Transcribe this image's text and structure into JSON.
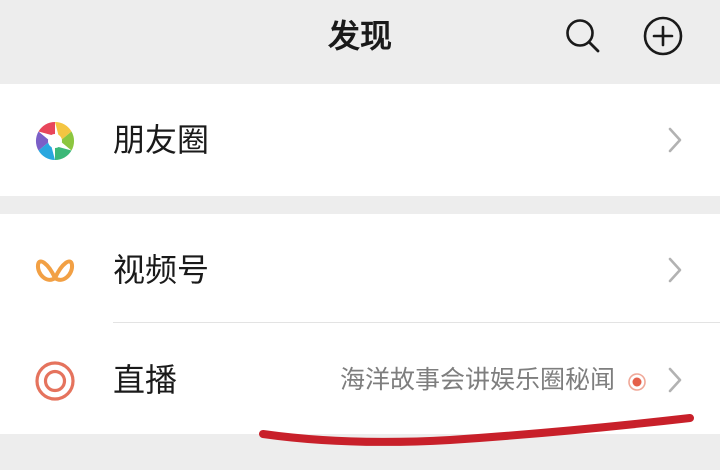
{
  "header": {
    "title": "发现",
    "search_icon": "search-icon",
    "add_icon": "plus-circle-icon"
  },
  "items": [
    {
      "label": "朋友圈",
      "icon": "moments-aperture-icon"
    },
    {
      "label": "视频号",
      "icon": "channels-butterfly-icon",
      "accent": "#f2a044"
    },
    {
      "label": "直播",
      "icon": "live-ring-icon",
      "subtitle": "海洋故事会讲娱乐圈秘闻",
      "accent": "#e5735d"
    }
  ],
  "annotation": {
    "color": "#c8202a"
  }
}
